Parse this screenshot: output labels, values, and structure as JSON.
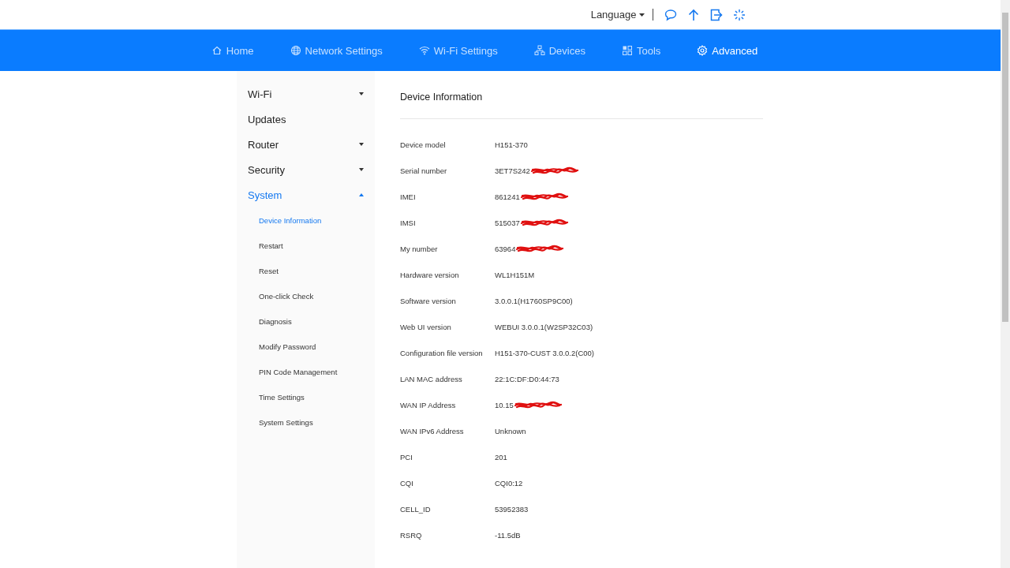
{
  "top_bar": {
    "language": "Language"
  },
  "nav": [
    {
      "label": "Home",
      "selected": false
    },
    {
      "label": "Network Settings",
      "selected": false
    },
    {
      "label": "Wi-Fi Settings",
      "selected": false
    },
    {
      "label": "Devices",
      "selected": false
    },
    {
      "label": "Tools",
      "selected": false
    },
    {
      "label": "Advanced",
      "selected": true
    }
  ],
  "sidebar": {
    "items": [
      {
        "label": "Wi-Fi",
        "expanded": false,
        "has_children": true,
        "selected": false
      },
      {
        "label": "Updates",
        "has_children": false,
        "selected": false
      },
      {
        "label": "Router",
        "expanded": false,
        "has_children": true,
        "selected": false
      },
      {
        "label": "Security",
        "expanded": false,
        "has_children": true,
        "selected": false
      },
      {
        "label": "System",
        "expanded": true,
        "has_children": true,
        "selected": true,
        "children": [
          {
            "label": "Device Information",
            "selected": true
          },
          {
            "label": "Restart",
            "selected": false
          },
          {
            "label": "Reset",
            "selected": false
          },
          {
            "label": "One-click Check",
            "selected": false
          },
          {
            "label": "Diagnosis",
            "selected": false
          },
          {
            "label": "Modify Password",
            "selected": false
          },
          {
            "label": "PIN Code Management",
            "selected": false
          },
          {
            "label": "Time Settings",
            "selected": false
          },
          {
            "label": "System Settings",
            "selected": false
          }
        ]
      }
    ]
  },
  "panel": {
    "title": "Device Information",
    "rows": [
      {
        "label": "Device model",
        "value": "H151-370",
        "redacted": false
      },
      {
        "label": "Serial number",
        "value": "3ET7S242",
        "redacted": true
      },
      {
        "label": "IMEI",
        "value": "861241",
        "redacted": true
      },
      {
        "label": "IMSI",
        "value": "515037",
        "redacted": true
      },
      {
        "label": "My number",
        "value": "63964",
        "redacted": true
      },
      {
        "label": "Hardware version",
        "value": "WL1H151M",
        "redacted": false
      },
      {
        "label": "Software version",
        "value": "3.0.0.1(H1760SP9C00)",
        "redacted": false
      },
      {
        "label": "Web UI version",
        "value": "WEBUI 3.0.0.1(W2SP32C03)",
        "redacted": false
      },
      {
        "label": "Configuration file version",
        "value": "H151-370-CUST 3.0.0.2(C00)",
        "redacted": false
      },
      {
        "label": "LAN MAC address",
        "value": "22:1C:DF:D0:44:73",
        "redacted": false
      },
      {
        "label": "WAN IP Address",
        "value": "10.15",
        "redacted": true
      },
      {
        "label": "WAN IPv6 Address",
        "value": "Unknown",
        "redacted": false
      },
      {
        "label": "PCI",
        "value": "201",
        "redacted": false
      },
      {
        "label": "CQI",
        "value": "CQI0:12",
        "redacted": false
      },
      {
        "label": "CELL_ID",
        "value": "53952383",
        "redacted": false
      },
      {
        "label": "RSRQ",
        "value": "-11.5dB",
        "redacted": false
      }
    ]
  }
}
